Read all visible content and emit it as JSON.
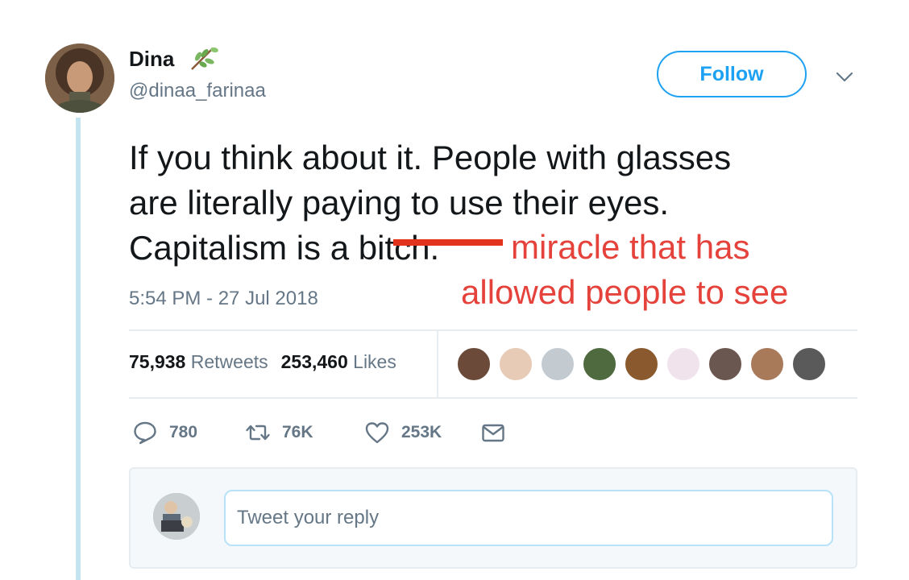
{
  "author": {
    "display_name": "Dina",
    "name_emoji": "herb-icon",
    "handle": "@dinaa_farinaa"
  },
  "header": {
    "follow_label": "Follow",
    "more_icon": "chevron-down-icon"
  },
  "tweet": {
    "text_line1": "If you think about it. People with glasses",
    "text_line2": "are literally paying to use their eyes.",
    "text_line3_prefix": "Capitalism is a ",
    "struck_word": "bitch.",
    "edit_line1": "miracle that has",
    "edit_line2": "allowed people to see",
    "timestamp": "5:54 PM - 27 Jul 2018"
  },
  "stats": {
    "retweets_count": "75,938",
    "retweets_label": "Retweets",
    "likes_count": "253,460",
    "likes_label": "Likes",
    "liker_avatars": 9
  },
  "actions": {
    "reply_count": "780",
    "retweet_count": "76K",
    "like_count": "253K"
  },
  "reply": {
    "placeholder": "Tweet your reply"
  },
  "colors": {
    "accent": "#1da1f2",
    "secondary_text": "#657786",
    "edit_red": "#e4423b",
    "thread_line": "#c4e4f0"
  }
}
